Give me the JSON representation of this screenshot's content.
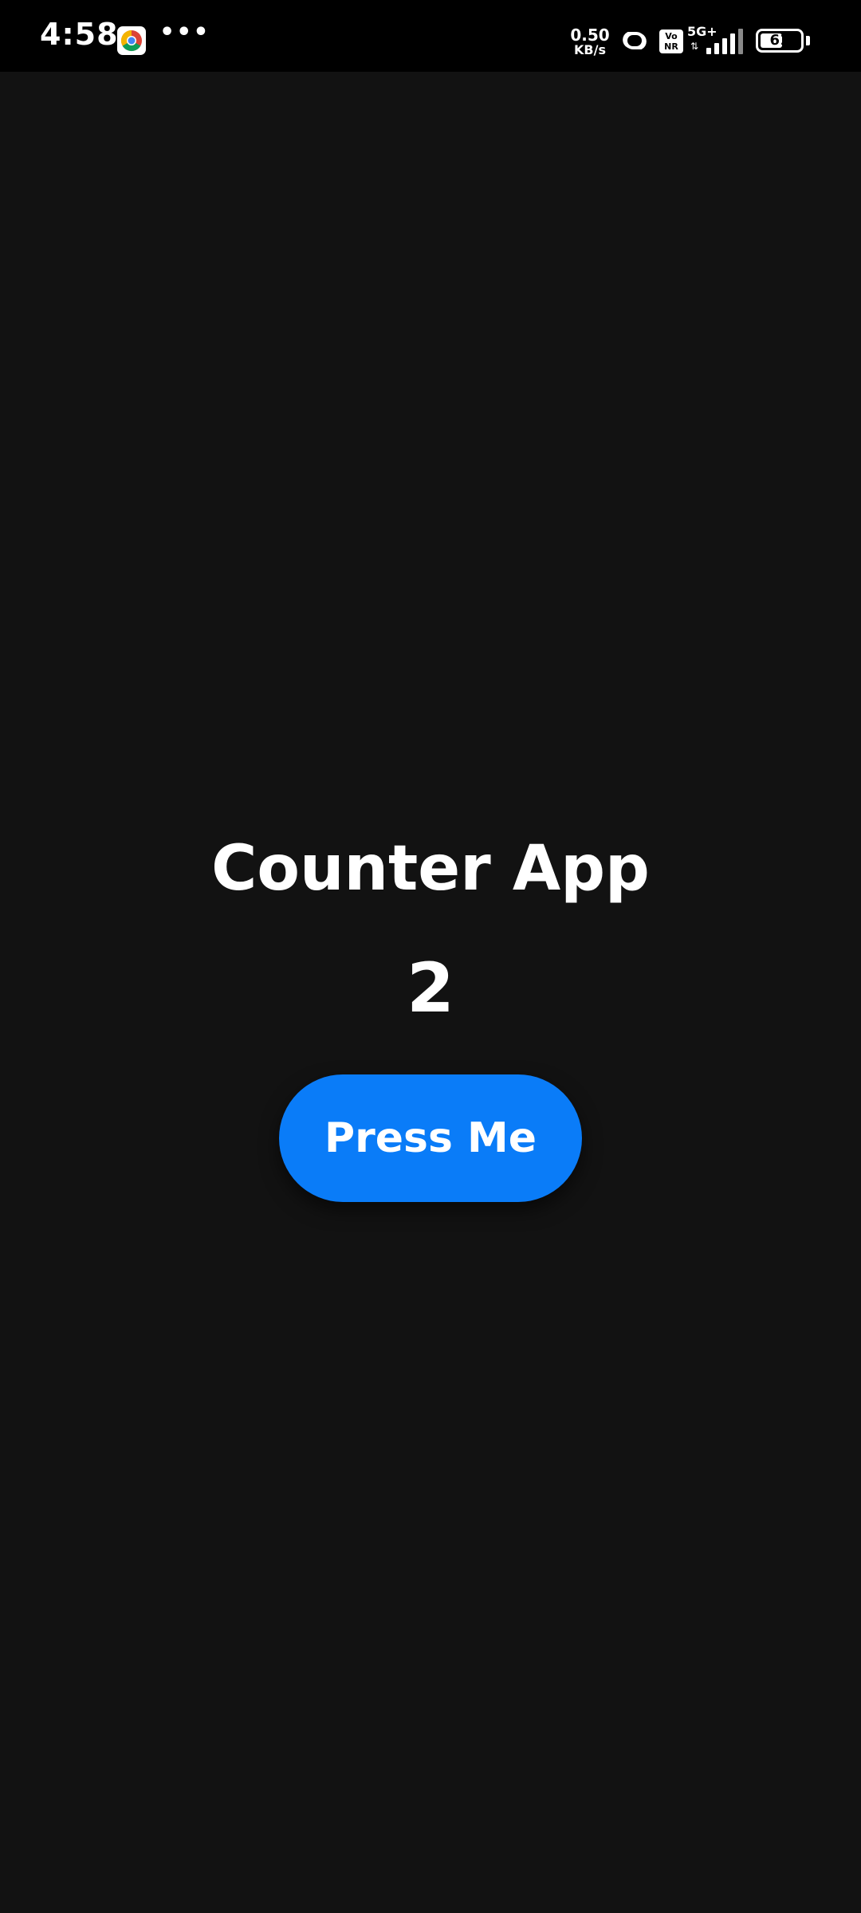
{
  "status_bar": {
    "time": "4:58",
    "more_indicator": "•••",
    "net_speed_value": "0.50",
    "net_speed_unit": "KB/s",
    "vonr_top": "Vo",
    "vonr_bottom": "NR",
    "network_type": "5G+",
    "battery_level": "61",
    "battery_fraction": 0.61,
    "icons": [
      "chrome-icon",
      "hotspot-icon",
      "vonr-icon",
      "signal-icon",
      "battery-icon"
    ]
  },
  "app": {
    "title": "Counter App",
    "counter": "2",
    "button_label": "Press Me"
  },
  "colors": {
    "background": "#121212",
    "status_bar": "#000000",
    "button": "#0a7cf8",
    "text": "#ffffff"
  }
}
